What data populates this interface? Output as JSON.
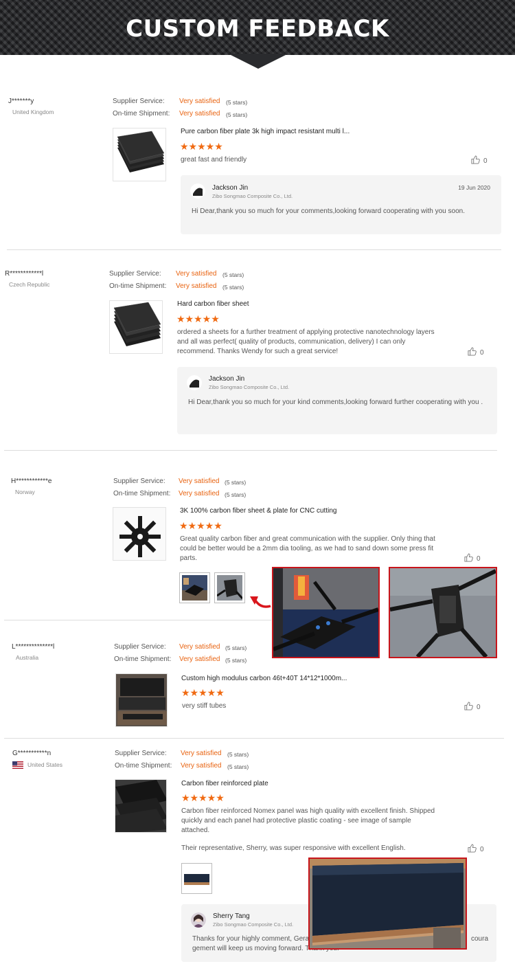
{
  "banner": {
    "title": "CUSTOM FEEDBACK"
  },
  "labels": {
    "supplier_service": "Supplier Service:",
    "ontime_shipment": "On-time Shipment:",
    "very_satisfied": "Very satisfied",
    "five_stars": "(5 stars)",
    "stars": "★★★★★"
  },
  "reviews": [
    {
      "name": "J*******y",
      "country": "United Kingdom",
      "product": "Pure carbon fiber plate 3k high impact resistant multi l...",
      "comment": "great fast and friendly",
      "likes": "0",
      "reply": {
        "name": "Jackson Jin",
        "company": "Zibo Songmao Composite Co., Ltd.",
        "date": "19 Jun 2020",
        "text": "Hi Dear,thank you so much for your comments,looking forward cooperating with you soon."
      }
    },
    {
      "name": "R************l",
      "country": "Czech Republic",
      "product": "Hard carbon fiber sheet",
      "comment": "ordered a sheets for a further treatment of applying protective nanotechnology layers and all was perfect( quality of products, communication, delivery) I can only recommend. Thanks Wendy for such a great service!",
      "likes": "0",
      "reply": {
        "name": "Jackson Jin",
        "company": "Zibo Songmao Composite Co., Ltd.",
        "date": "",
        "text": "Hi Dear,thank you so much for your kind comments,looking forward further cooperating with you ."
      }
    },
    {
      "name": "H************e",
      "country": "Norway",
      "product": "3K 100% carbon fiber sheet & plate for CNC cutting",
      "comment": "Great quality carbon fiber and great communication with the supplier. Only thing that could be better would be a 2mm dia tooling, as we had to sand down some press fit parts.",
      "likes": "0"
    },
    {
      "name": "L**************l",
      "country": "Australia",
      "product": "Custom high modulus carbon 46t+40T 14*12*1000m...",
      "comment": "very stiff tubes",
      "likes": "0"
    },
    {
      "name": "G***********n",
      "country": "United States",
      "product": "Carbon fiber reinforced plate",
      "comment": "Carbon fiber reinforced Nomex panel was high quality with excellent finish. Shipped quickly and each panel had protective plastic coating - see image of sample attached.",
      "comment2": "Their representative, Sherry, was super responsive with excellent English.",
      "likes": "0",
      "reply": {
        "name": "Sherry Tang",
        "company": "Zibo Songmao Composite Co., Ltd.",
        "text_left": "Thanks for your highly comment, Gera",
        "text_right": "coura",
        "text_line2": "gement will keep us moving forward. Thank you."
      }
    }
  ]
}
